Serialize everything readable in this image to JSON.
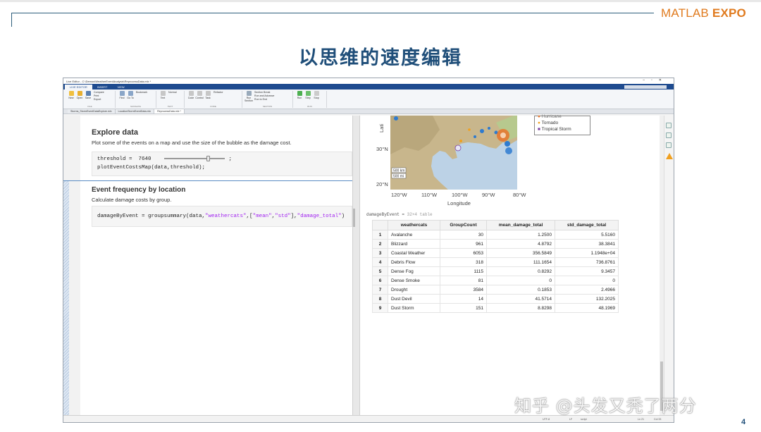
{
  "slide": {
    "title": "以思维的速度编辑",
    "logo_main": "MATLAB",
    "logo_expo": "EXPO",
    "page_number": "4",
    "watermark": "知乎 @头发又秃了两分"
  },
  "window": {
    "title": "Live Editor - C:\\Demos\\WeatherEventAnalysis\\ReprocessData.mlx *",
    "ribbon_tabs": [
      "LIVE EDITOR",
      "INSERT",
      "VIEW"
    ],
    "ribbon_buttons": {
      "new": "New",
      "open": "Open",
      "save": "Save",
      "compare": "Compare",
      "print": "Print",
      "export": "Export",
      "find": "Find",
      "goto": "Go To",
      "bookmark": "Bookmark",
      "text": "Text",
      "normal": "Normal",
      "code": "Code",
      "control": "Control",
      "task": "Task",
      "refactor": "Refactor",
      "run_section": "Run Section",
      "section_break": "Section Break",
      "run_advance": "Run and Advance",
      "run_to_end": "Run to End",
      "run": "Run",
      "step": "Step",
      "stop": "Stop"
    },
    "ribbon_groups": [
      "FILE",
      "NAVIGATE",
      "TEXT",
      "CODE",
      "SECTION",
      "RUN"
    ],
    "file_tabs": [
      "Storms_StormEventDataExplore.mlx",
      "LocationStormEventData.mlx",
      "ReprocessData.mlx *"
    ],
    "status": {
      "encoding": "UTF-8",
      "line_ending": "LF",
      "mode": "script",
      "ln": "Ln 21",
      "col": "Col 33"
    }
  },
  "editor": {
    "explore": {
      "heading": "Explore data",
      "description": "Plot some of the events on a map and use the size of the bubble as the damage cost.",
      "line1_var": "threshold =",
      "line1_value": "7640",
      "line1_end": ";",
      "line2": "plotEventCostsMap(data,threshold);"
    },
    "frequency": {
      "heading": "Event frequency by location",
      "description": "Calculate damage costs by group.",
      "code_prefix": "damageByEvent = groupsummary(data,",
      "code_str1": "\"weathercats\"",
      "code_mid": ",[",
      "code_str2": "\"mean\"",
      "code_comma": ",",
      "code_str3": "\"std\"",
      "code_mid2": "],",
      "code_str4": "\"damage_total\"",
      "code_end": ")"
    }
  },
  "output": {
    "map": {
      "lat_labels": [
        "30°N",
        "20°N"
      ],
      "lat_axis_partial": "Lati",
      "lon_labels": [
        "120°W",
        "110°W",
        "100°W",
        "90°W",
        "80°W"
      ],
      "xlabel": "Longitude",
      "scale": [
        "500 km",
        "500 mi"
      ],
      "legend": [
        "Hurricane",
        "Tornado",
        "Tropical Storm"
      ],
      "colors": {
        "ocean": "#bcd2e6",
        "land": "#c9b48a",
        "hurricane": "#e8742a",
        "tornado": "#f0a020",
        "tropical_storm": "#7b3fa0",
        "bubble": "#2e7bd0"
      }
    },
    "table": {
      "caption_var": "damageByEvent =",
      "caption_size": "32×4 table",
      "columns": [
        "weathercats",
        "GroupCount",
        "mean_damage_total",
        "std_damage_total"
      ],
      "rows": [
        [
          "1",
          "Avalanche",
          "30",
          "1.2500",
          "5.5160"
        ],
        [
          "2",
          "Blizzard",
          "961",
          "4.8792",
          "38.3841"
        ],
        [
          "3",
          "Coastal Weather",
          "6053",
          "356.5849",
          "1.1948e+04"
        ],
        [
          "4",
          "Debris Flow",
          "318",
          "111.1654",
          "736.8761"
        ],
        [
          "5",
          "Dense Fog",
          "1115",
          "0.8292",
          "9.3457"
        ],
        [
          "6",
          "Dense Smoke",
          "81",
          "0",
          "0"
        ],
        [
          "7",
          "Drought",
          "3584",
          "0.1853",
          "2.4966"
        ],
        [
          "8",
          "Dust Devil",
          "14",
          "41.5714",
          "132.2025"
        ],
        [
          "9",
          "Dust Storm",
          "151",
          "8.8298",
          "48.1969"
        ]
      ]
    }
  }
}
